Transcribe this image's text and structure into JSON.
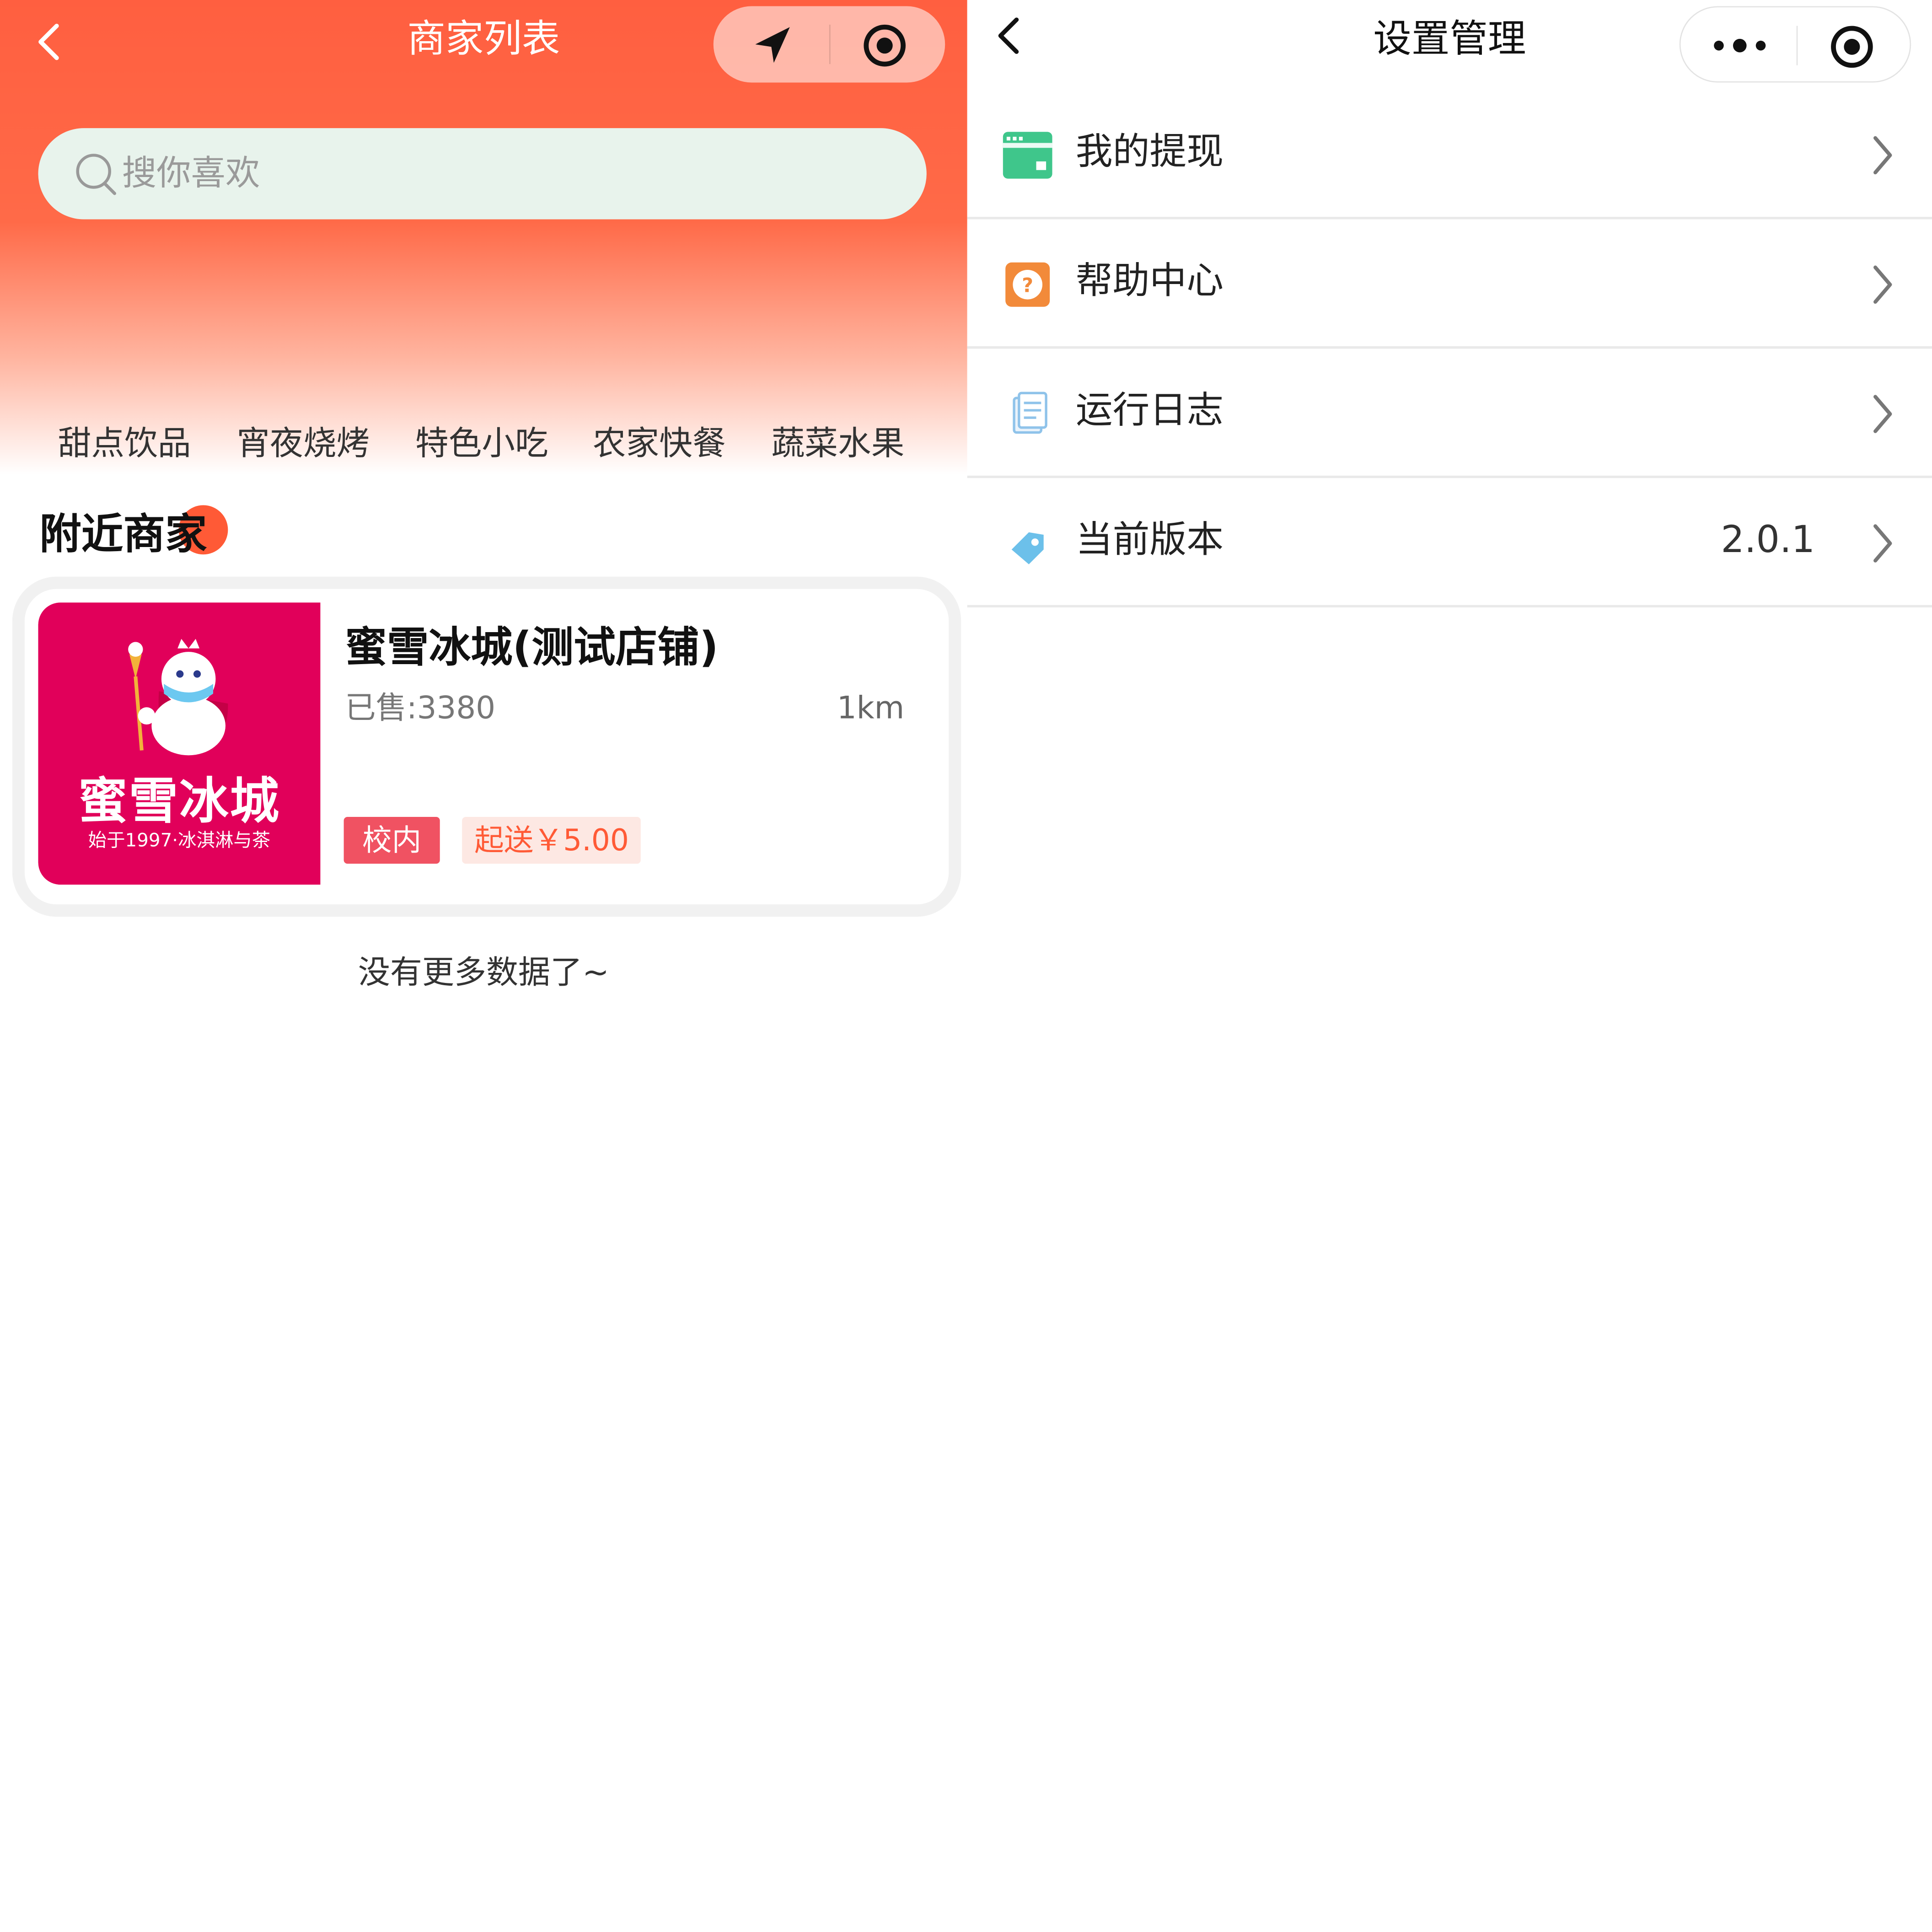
{
  "left": {
    "title": "商家列表",
    "search_placeholder": "搜你喜欢",
    "categories": [
      "甜点饮品",
      "宵夜烧烤",
      "特色小吃",
      "农家快餐",
      "蔬菜水果"
    ],
    "section_title": "附近商家",
    "shop": {
      "name": "蜜雪冰城(测试店铺)",
      "logo_brand": "蜜雪冰城",
      "logo_slogan": "始于1997·冰淇淋与茶",
      "sold": "已售:3380",
      "distance": "1km",
      "tag_campus": "校内",
      "tag_min_order": "起送￥5.00"
    },
    "no_more": "没有更多数据了~",
    "colors": {
      "brand": "#ff5f40",
      "logo_bg": "#e1005a",
      "tag_red": "#f05262"
    }
  },
  "right": {
    "title": "设置管理",
    "items": [
      {
        "label": "我的提现",
        "icon": "wallet-card-icon",
        "value": ""
      },
      {
        "label": "帮助中心",
        "icon": "help-question-icon",
        "value": ""
      },
      {
        "label": "运行日志",
        "icon": "document-log-icon",
        "value": ""
      },
      {
        "label": "当前版本",
        "icon": "version-tag-icon",
        "value": "2.0.1"
      }
    ]
  }
}
